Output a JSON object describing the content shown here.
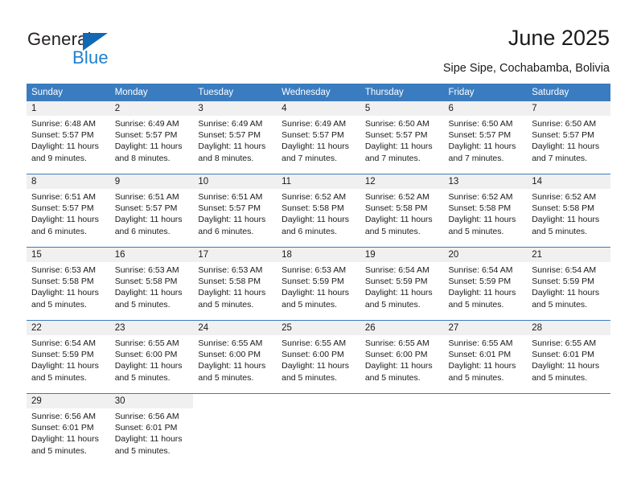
{
  "brand": {
    "name_part1": "General",
    "name_part2": "Blue",
    "logo_icon": "triangle-icon",
    "accent_color": "#1268b3",
    "accent_color_light": "#1f7fd0"
  },
  "header": {
    "title": "June 2025",
    "subtitle": "Sipe Sipe, Cochabamba, Bolivia"
  },
  "calendar": {
    "header_bg": "#3a7cc0",
    "daynum_bg": "#f0f0f0",
    "weekday_headers": [
      "Sunday",
      "Monday",
      "Tuesday",
      "Wednesday",
      "Thursday",
      "Friday",
      "Saturday"
    ],
    "weeks": [
      [
        {
          "day": "1",
          "sunrise": "Sunrise: 6:48 AM",
          "sunset": "Sunset: 5:57 PM",
          "daylight1": "Daylight: 11 hours",
          "daylight2": "and 9 minutes."
        },
        {
          "day": "2",
          "sunrise": "Sunrise: 6:49 AM",
          "sunset": "Sunset: 5:57 PM",
          "daylight1": "Daylight: 11 hours",
          "daylight2": "and 8 minutes."
        },
        {
          "day": "3",
          "sunrise": "Sunrise: 6:49 AM",
          "sunset": "Sunset: 5:57 PM",
          "daylight1": "Daylight: 11 hours",
          "daylight2": "and 8 minutes."
        },
        {
          "day": "4",
          "sunrise": "Sunrise: 6:49 AM",
          "sunset": "Sunset: 5:57 PM",
          "daylight1": "Daylight: 11 hours",
          "daylight2": "and 7 minutes."
        },
        {
          "day": "5",
          "sunrise": "Sunrise: 6:50 AM",
          "sunset": "Sunset: 5:57 PM",
          "daylight1": "Daylight: 11 hours",
          "daylight2": "and 7 minutes."
        },
        {
          "day": "6",
          "sunrise": "Sunrise: 6:50 AM",
          "sunset": "Sunset: 5:57 PM",
          "daylight1": "Daylight: 11 hours",
          "daylight2": "and 7 minutes."
        },
        {
          "day": "7",
          "sunrise": "Sunrise: 6:50 AM",
          "sunset": "Sunset: 5:57 PM",
          "daylight1": "Daylight: 11 hours",
          "daylight2": "and 7 minutes."
        }
      ],
      [
        {
          "day": "8",
          "sunrise": "Sunrise: 6:51 AM",
          "sunset": "Sunset: 5:57 PM",
          "daylight1": "Daylight: 11 hours",
          "daylight2": "and 6 minutes."
        },
        {
          "day": "9",
          "sunrise": "Sunrise: 6:51 AM",
          "sunset": "Sunset: 5:57 PM",
          "daylight1": "Daylight: 11 hours",
          "daylight2": "and 6 minutes."
        },
        {
          "day": "10",
          "sunrise": "Sunrise: 6:51 AM",
          "sunset": "Sunset: 5:57 PM",
          "daylight1": "Daylight: 11 hours",
          "daylight2": "and 6 minutes."
        },
        {
          "day": "11",
          "sunrise": "Sunrise: 6:52 AM",
          "sunset": "Sunset: 5:58 PM",
          "daylight1": "Daylight: 11 hours",
          "daylight2": "and 6 minutes."
        },
        {
          "day": "12",
          "sunrise": "Sunrise: 6:52 AM",
          "sunset": "Sunset: 5:58 PM",
          "daylight1": "Daylight: 11 hours",
          "daylight2": "and 5 minutes."
        },
        {
          "day": "13",
          "sunrise": "Sunrise: 6:52 AM",
          "sunset": "Sunset: 5:58 PM",
          "daylight1": "Daylight: 11 hours",
          "daylight2": "and 5 minutes."
        },
        {
          "day": "14",
          "sunrise": "Sunrise: 6:52 AM",
          "sunset": "Sunset: 5:58 PM",
          "daylight1": "Daylight: 11 hours",
          "daylight2": "and 5 minutes."
        }
      ],
      [
        {
          "day": "15",
          "sunrise": "Sunrise: 6:53 AM",
          "sunset": "Sunset: 5:58 PM",
          "daylight1": "Daylight: 11 hours",
          "daylight2": "and 5 minutes."
        },
        {
          "day": "16",
          "sunrise": "Sunrise: 6:53 AM",
          "sunset": "Sunset: 5:58 PM",
          "daylight1": "Daylight: 11 hours",
          "daylight2": "and 5 minutes."
        },
        {
          "day": "17",
          "sunrise": "Sunrise: 6:53 AM",
          "sunset": "Sunset: 5:58 PM",
          "daylight1": "Daylight: 11 hours",
          "daylight2": "and 5 minutes."
        },
        {
          "day": "18",
          "sunrise": "Sunrise: 6:53 AM",
          "sunset": "Sunset: 5:59 PM",
          "daylight1": "Daylight: 11 hours",
          "daylight2": "and 5 minutes."
        },
        {
          "day": "19",
          "sunrise": "Sunrise: 6:54 AM",
          "sunset": "Sunset: 5:59 PM",
          "daylight1": "Daylight: 11 hours",
          "daylight2": "and 5 minutes."
        },
        {
          "day": "20",
          "sunrise": "Sunrise: 6:54 AM",
          "sunset": "Sunset: 5:59 PM",
          "daylight1": "Daylight: 11 hours",
          "daylight2": "and 5 minutes."
        },
        {
          "day": "21",
          "sunrise": "Sunrise: 6:54 AM",
          "sunset": "Sunset: 5:59 PM",
          "daylight1": "Daylight: 11 hours",
          "daylight2": "and 5 minutes."
        }
      ],
      [
        {
          "day": "22",
          "sunrise": "Sunrise: 6:54 AM",
          "sunset": "Sunset: 5:59 PM",
          "daylight1": "Daylight: 11 hours",
          "daylight2": "and 5 minutes."
        },
        {
          "day": "23",
          "sunrise": "Sunrise: 6:55 AM",
          "sunset": "Sunset: 6:00 PM",
          "daylight1": "Daylight: 11 hours",
          "daylight2": "and 5 minutes."
        },
        {
          "day": "24",
          "sunrise": "Sunrise: 6:55 AM",
          "sunset": "Sunset: 6:00 PM",
          "daylight1": "Daylight: 11 hours",
          "daylight2": "and 5 minutes."
        },
        {
          "day": "25",
          "sunrise": "Sunrise: 6:55 AM",
          "sunset": "Sunset: 6:00 PM",
          "daylight1": "Daylight: 11 hours",
          "daylight2": "and 5 minutes."
        },
        {
          "day": "26",
          "sunrise": "Sunrise: 6:55 AM",
          "sunset": "Sunset: 6:00 PM",
          "daylight1": "Daylight: 11 hours",
          "daylight2": "and 5 minutes."
        },
        {
          "day": "27",
          "sunrise": "Sunrise: 6:55 AM",
          "sunset": "Sunset: 6:01 PM",
          "daylight1": "Daylight: 11 hours",
          "daylight2": "and 5 minutes."
        },
        {
          "day": "28",
          "sunrise": "Sunrise: 6:55 AM",
          "sunset": "Sunset: 6:01 PM",
          "daylight1": "Daylight: 11 hours",
          "daylight2": "and 5 minutes."
        }
      ],
      [
        {
          "day": "29",
          "sunrise": "Sunrise: 6:56 AM",
          "sunset": "Sunset: 6:01 PM",
          "daylight1": "Daylight: 11 hours",
          "daylight2": "and 5 minutes."
        },
        {
          "day": "30",
          "sunrise": "Sunrise: 6:56 AM",
          "sunset": "Sunset: 6:01 PM",
          "daylight1": "Daylight: 11 hours",
          "daylight2": "and 5 minutes."
        },
        {
          "day": "",
          "sunrise": "",
          "sunset": "",
          "daylight1": "",
          "daylight2": ""
        },
        {
          "day": "",
          "sunrise": "",
          "sunset": "",
          "daylight1": "",
          "daylight2": ""
        },
        {
          "day": "",
          "sunrise": "",
          "sunset": "",
          "daylight1": "",
          "daylight2": ""
        },
        {
          "day": "",
          "sunrise": "",
          "sunset": "",
          "daylight1": "",
          "daylight2": ""
        },
        {
          "day": "",
          "sunrise": "",
          "sunset": "",
          "daylight1": "",
          "daylight2": ""
        }
      ]
    ]
  }
}
